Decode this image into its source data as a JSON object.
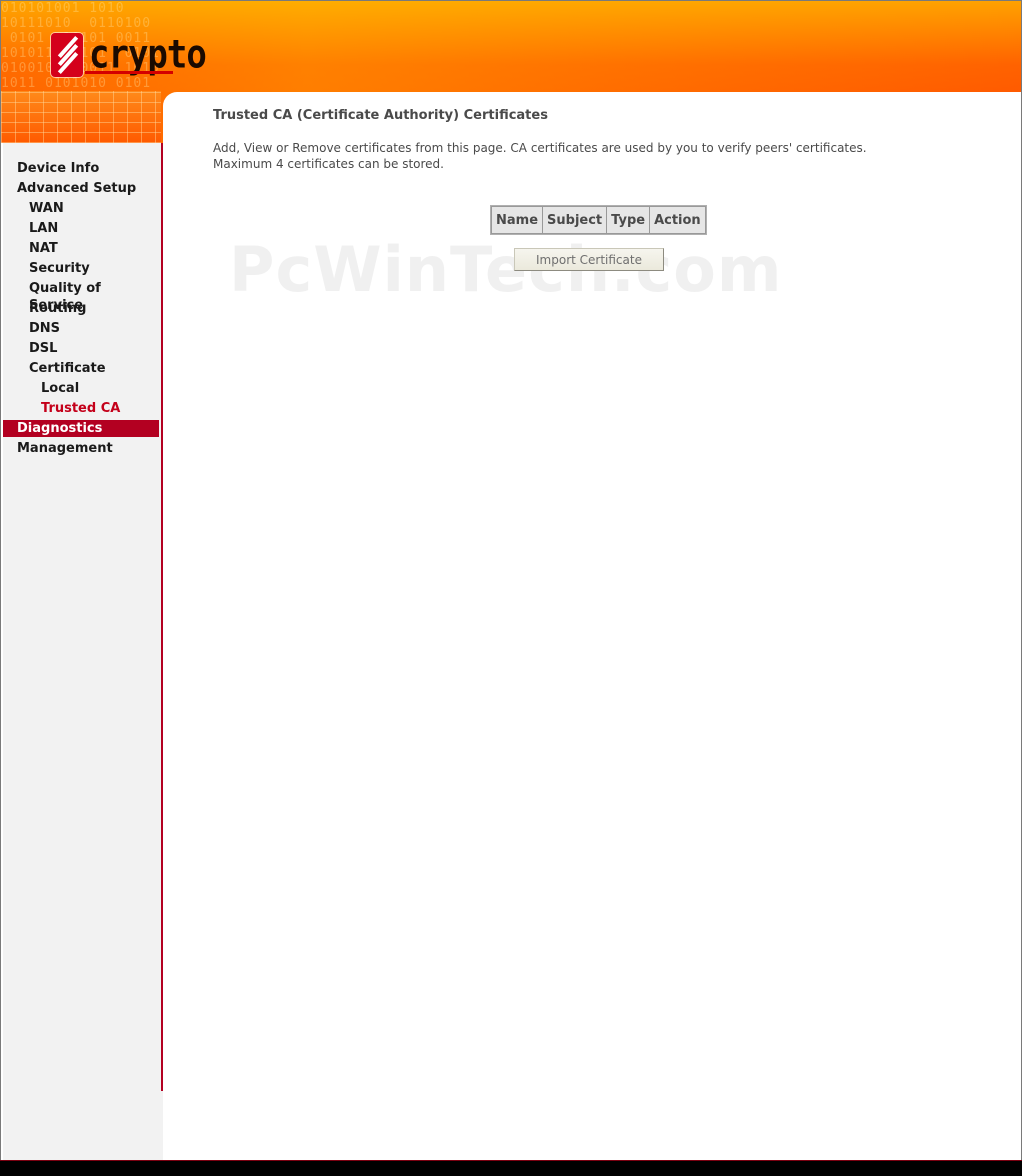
{
  "brand": {
    "logo_text": "crypto"
  },
  "sidebar": {
    "items": [
      {
        "label": "Device Info",
        "level": 0,
        "state": "normal"
      },
      {
        "label": "Advanced Setup",
        "level": 0,
        "state": "normal"
      },
      {
        "label": "WAN",
        "level": 1,
        "state": "normal"
      },
      {
        "label": "LAN",
        "level": 1,
        "state": "normal"
      },
      {
        "label": "NAT",
        "level": 1,
        "state": "normal"
      },
      {
        "label": "Security",
        "level": 1,
        "state": "normal"
      },
      {
        "label": "Quality of Service",
        "level": 1,
        "state": "normal"
      },
      {
        "label": "Routing",
        "level": 1,
        "state": "normal"
      },
      {
        "label": "DNS",
        "level": 1,
        "state": "normal"
      },
      {
        "label": "DSL",
        "level": 1,
        "state": "normal"
      },
      {
        "label": "Certificate",
        "level": 1,
        "state": "normal"
      },
      {
        "label": "Local",
        "level": 2,
        "state": "normal"
      },
      {
        "label": "Trusted CA",
        "level": 2,
        "state": "current"
      },
      {
        "label": "Diagnostics",
        "level": 0,
        "state": "active"
      },
      {
        "label": "Management",
        "level": 0,
        "state": "normal"
      }
    ]
  },
  "main": {
    "title": "Trusted CA (Certificate Authority) Certificates",
    "description_line1": "Add, View or Remove certificates from this page. CA certificates are used by you to verify peers' certificates.",
    "description_line2": "Maximum 4 certificates can be stored.",
    "table": {
      "headers": [
        "Name",
        "Subject",
        "Type",
        "Action"
      ]
    },
    "import_button_label": "Import Certificate"
  },
  "watermark": "PcWinTech.com",
  "colors": {
    "header_orange": "#ff6a00",
    "accent_red": "#b30021",
    "current_item_red": "#c4001a",
    "sidebar_bg": "#f2f2f2"
  }
}
